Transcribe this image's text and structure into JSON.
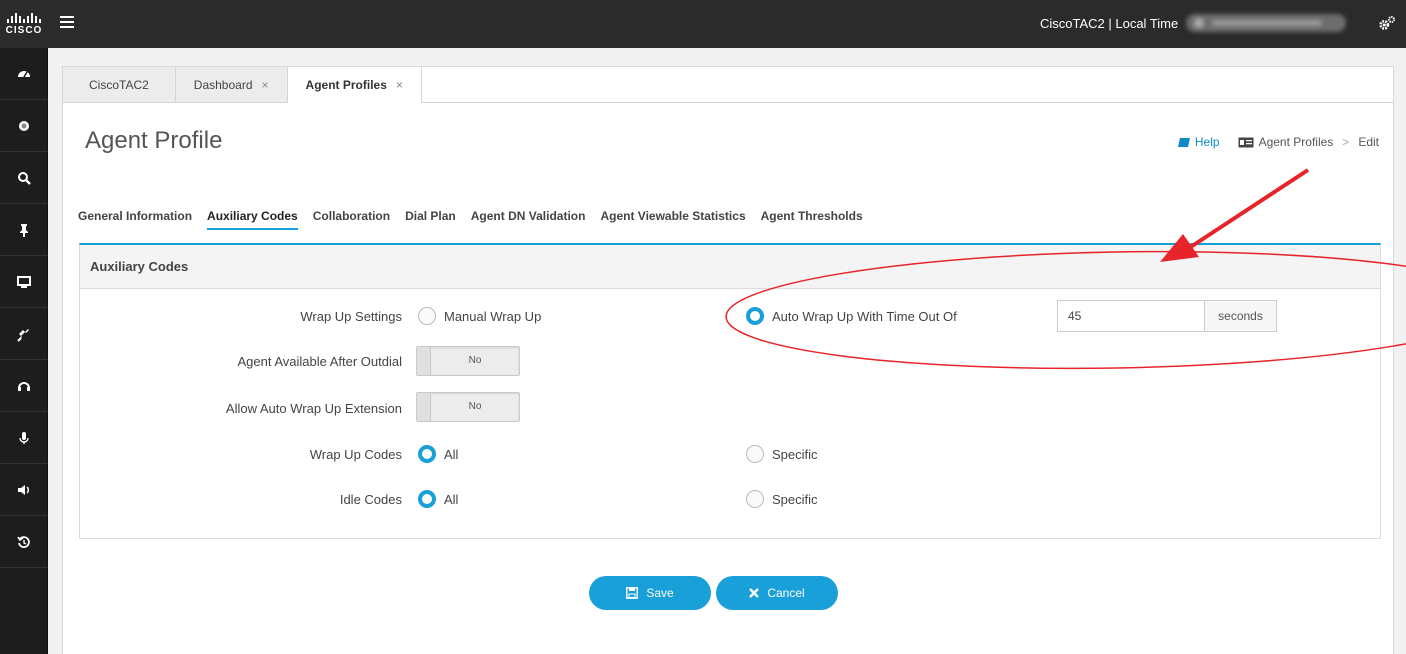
{
  "topbar": {
    "logo_text": "CISCO",
    "tenant_label": "CiscoTAC2 | Local Time"
  },
  "tabs": [
    {
      "label": "CiscoTAC2",
      "closable": false,
      "active": false
    },
    {
      "label": "Dashboard",
      "closable": true,
      "active": false
    },
    {
      "label": "Agent Profiles",
      "closable": true,
      "active": true
    }
  ],
  "tab_close_glyph": "×",
  "page": {
    "title": "Agent Profile",
    "help_label": "Help",
    "breadcrumb_link": "Agent Profiles",
    "breadcrumb_sep": ">",
    "breadcrumb_current": "Edit"
  },
  "subtabs": [
    "General Information",
    "Auxiliary Codes",
    "Collaboration",
    "Dial Plan",
    "Agent DN Validation",
    "Agent Viewable Statistics",
    "Agent Thresholds"
  ],
  "active_subtab": "Auxiliary Codes",
  "section": {
    "title": "Auxiliary Codes",
    "wrap_up_settings": {
      "label": "Wrap Up Settings",
      "manual_label": "Manual Wrap Up",
      "manual_checked": false,
      "auto_label": "Auto Wrap Up With Time Out Of",
      "auto_checked": true,
      "timeout_value": "45",
      "timeout_unit": "seconds"
    },
    "agent_available_after_outdial": {
      "label": "Agent Available After Outdial",
      "value": "No"
    },
    "allow_auto_wrap_up_extension": {
      "label": "Allow Auto Wrap Up Extension",
      "value": "No"
    },
    "wrap_up_codes": {
      "label": "Wrap Up Codes",
      "all_label": "All",
      "all_checked": true,
      "specific_label": "Specific",
      "specific_checked": false
    },
    "idle_codes": {
      "label": "Idle Codes",
      "all_label": "All",
      "all_checked": true,
      "specific_label": "Specific",
      "specific_checked": false
    }
  },
  "buttons": {
    "save": "Save",
    "cancel": "Cancel"
  },
  "sidebar_icons": [
    "dashboard-icon",
    "record-icon",
    "search-icon",
    "pin-icon",
    "desktop-icon",
    "plug-icon",
    "headset-icon",
    "microphone-icon",
    "speaker-icon",
    "history-icon"
  ],
  "colors": {
    "accent": "#1aa0d8",
    "topbar_bg": "#2b2b2b",
    "sidebar_bg": "#1d1d1d",
    "annotation": "#e8242a"
  }
}
